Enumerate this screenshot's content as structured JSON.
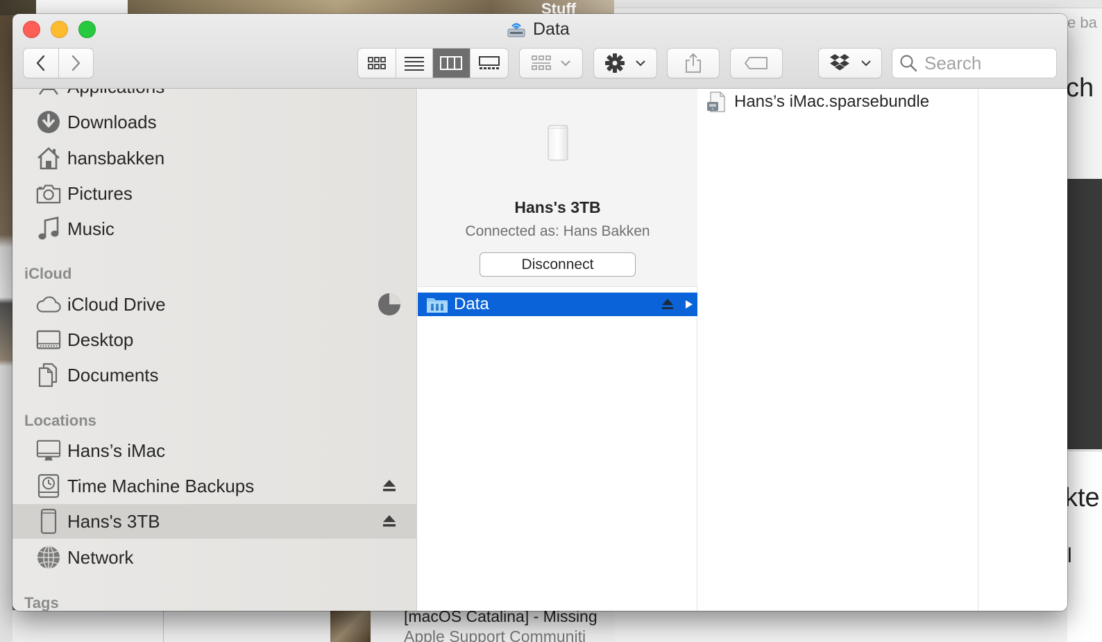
{
  "window": {
    "title": "Data",
    "title_icon": "network-volume-icon"
  },
  "toolbar": {
    "back_icon": "chevron-left-icon",
    "forward_icon": "chevron-right-icon",
    "view_modes": [
      "icon-view",
      "list-view",
      "column-view",
      "gallery-view"
    ],
    "active_view": "column-view",
    "search": {
      "placeholder": "Search"
    }
  },
  "sidebar": {
    "partial_item": "Applications",
    "favorites": [
      {
        "label": "Downloads",
        "icon": "downloads-icon"
      },
      {
        "label": "hansbakken",
        "icon": "home-icon"
      },
      {
        "label": "Pictures",
        "icon": "camera-icon"
      },
      {
        "label": "Music",
        "icon": "music-note-icon"
      }
    ],
    "icloud_header": "iCloud",
    "icloud": [
      {
        "label": "iCloud Drive",
        "icon": "cloud-icon",
        "progress": 0.75
      },
      {
        "label": "Desktop",
        "icon": "desktop-folder-icon"
      },
      {
        "label": "Documents",
        "icon": "document-icon"
      }
    ],
    "locations_header": "Locations",
    "locations": [
      {
        "label": "Hans’s iMac",
        "icon": "imac-icon"
      },
      {
        "label": "Time Machine Backups",
        "icon": "time-machine-disk-icon",
        "ejectable": true
      },
      {
        "label": "Hans's 3TB",
        "icon": "airport-disk-icon",
        "ejectable": true,
        "selected": true
      },
      {
        "label": "Network",
        "icon": "globe-icon"
      }
    ],
    "tags_header": "Tags"
  },
  "preview": {
    "name": "Hans's 3TB",
    "connected_as": "Connected as: Hans Bakken",
    "disconnect_label": "Disconnect"
  },
  "column1": {
    "items": [
      {
        "label": "Data",
        "selected": true
      }
    ]
  },
  "column2": {
    "items": [
      {
        "label": "Hans’s iMac.sparsebundle"
      }
    ]
  },
  "background": {
    "stuff_label": "Stuff",
    "bottom_text": "[macOS Catalina] - Missing",
    "bottom_text2": "Apple Support Communiti",
    "right_fragments": [
      "e ba",
      "ch",
      "kte",
      "l"
    ]
  },
  "colors": {
    "selection": "#0a63d8",
    "close": "#fd5f57",
    "minimize": "#febb2e",
    "maximize": "#28c840"
  }
}
